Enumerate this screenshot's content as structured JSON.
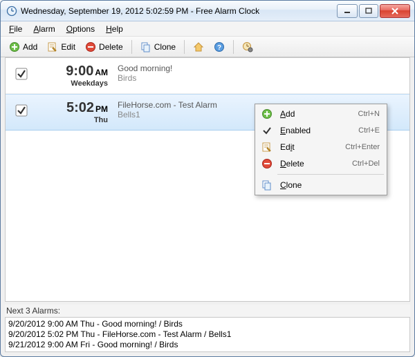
{
  "titlebar": {
    "title": "Wednesday, September 19, 2012 5:02:59 PM - Free Alarm Clock"
  },
  "menubar": {
    "file": "File",
    "alarm": "Alarm",
    "options": "Options",
    "help": "Help"
  },
  "toolbar": {
    "add": "Add",
    "edit": "Edit",
    "delete": "Delete",
    "clone": "Clone"
  },
  "alarms": [
    {
      "time": "9:00",
      "ampm": "AM",
      "days": "Weekdays",
      "title": "Good morning!",
      "sound": "Birds",
      "checked": true,
      "selected": false
    },
    {
      "time": "5:02",
      "ampm": "PM",
      "days": "Thu",
      "title": "FileHorse.com - Test Alarm",
      "sound": "Bells1",
      "checked": true,
      "selected": true
    }
  ],
  "context_menu": {
    "add": {
      "label": "Add",
      "shortcut": "Ctrl+N"
    },
    "enabled": {
      "label": "Enabled",
      "shortcut": "Ctrl+E",
      "checked": true
    },
    "edit": {
      "label": "Edit",
      "shortcut": "Ctrl+Enter"
    },
    "delete": {
      "label": "Delete",
      "shortcut": "Ctrl+Del"
    },
    "clone": {
      "label": "Clone",
      "shortcut": ""
    }
  },
  "footer": {
    "label": "Next 3 Alarms:",
    "items": [
      "9/20/2012 9:00 AM Thu - Good morning! / Birds",
      "9/20/2012 5:02 PM Thu - FileHorse.com - Test Alarm / Bells1",
      "9/21/2012 9:00 AM Fri - Good morning! / Birds"
    ]
  }
}
